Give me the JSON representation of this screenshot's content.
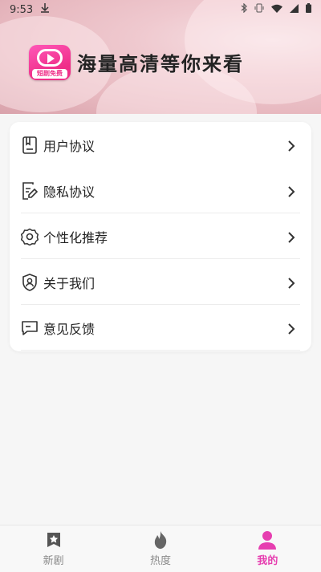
{
  "status_bar": {
    "time": "9:53",
    "icons": [
      "download-icon",
      "bluetooth-icon",
      "vibrate-icon",
      "wifi-icon",
      "signal-icon",
      "battery-icon"
    ]
  },
  "header": {
    "logo_text": "短剧免费",
    "slogan": "海量高清等你来看"
  },
  "menu": {
    "items": [
      {
        "label": "用户协议",
        "icon": "document-icon"
      },
      {
        "label": "隐私协议",
        "icon": "edit-document-icon"
      },
      {
        "label": "个性化推荐",
        "icon": "gear-icon"
      },
      {
        "label": "关于我们",
        "icon": "shield-user-icon"
      },
      {
        "label": "意见反馈",
        "icon": "chat-icon"
      }
    ]
  },
  "bottom_nav": {
    "items": [
      {
        "label": "新剧",
        "icon": "star-bookmark-icon",
        "active": false
      },
      {
        "label": "热度",
        "icon": "flame-icon",
        "active": false
      },
      {
        "label": "我的",
        "icon": "person-icon",
        "active": true
      }
    ]
  },
  "colors": {
    "accent": "#e63fb0",
    "logo": "#ef2e88",
    "inactive": "#8a8a8a"
  }
}
